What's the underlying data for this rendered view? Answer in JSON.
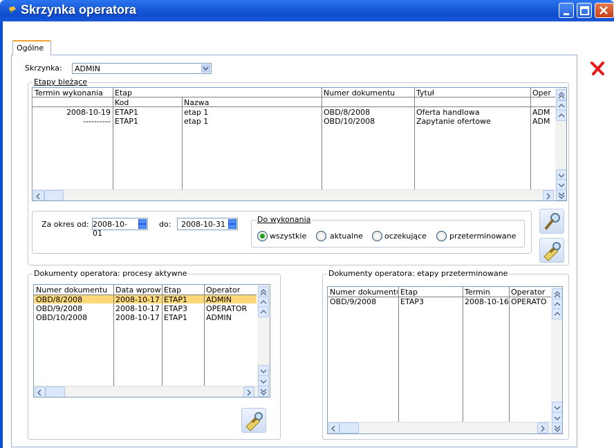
{
  "window": {
    "title": "Skrzynka operatora"
  },
  "tabs": [
    {
      "label": "Ogólne"
    }
  ],
  "skrzynka": {
    "label": "Skrzynka:",
    "value": "ADMIN"
  },
  "etapy": {
    "legend": "Etapy bieżące",
    "headers": {
      "termin": "Termin wykonania",
      "etap": "Etap",
      "kod": "Kod",
      "nazwa": "Nazwa",
      "numer": "Numer dokumentu",
      "tytul": "Tytuł",
      "operator": "Oper"
    },
    "rows": [
      {
        "termin": "2008-10-19",
        "kod": "ETAP1",
        "nazwa": "etap 1",
        "numer": "OBD/8/2008",
        "tytul": "Oferta handlowa",
        "operator": "ADM"
      },
      {
        "termin": "----------",
        "kod": "ETAP1",
        "nazwa": "etap 1",
        "numer": "OBD/10/2008",
        "tytul": "Zapytanie ofertowe",
        "operator": "ADM"
      }
    ]
  },
  "filter": {
    "okres_label": "Za okres od:",
    "od": "2008-10-01",
    "do_label": "do:",
    "do": "2008-10-31",
    "wykonanie_legend": "Do wykonania",
    "options": [
      "wszystkie",
      "aktualne",
      "oczekujące",
      "przeterminowane"
    ],
    "selected": "wszystkie"
  },
  "procesy": {
    "legend": "Dokumenty operatora: procesy aktywne",
    "headers": [
      "Numer dokumentu",
      "Data wprow",
      "Etap",
      "Operator"
    ],
    "rows": [
      [
        "OBD/8/2008",
        "2008-10-17",
        "ETAP1",
        "ADMIN"
      ],
      [
        "OBD/9/2008",
        "2008-10-17",
        "ETAP3",
        "OPERATOR"
      ],
      [
        "OBD/10/2008",
        "2008-10-17",
        "ETAP1",
        "ADMIN"
      ]
    ],
    "selected_row": 0
  },
  "przeterminowane": {
    "legend": "Dokumenty operatora: etapy przeterminowane",
    "headers": [
      "Numer dokumentu",
      "Etap",
      "Termin",
      "Operator"
    ],
    "rows": [
      [
        "OBD/9/2008",
        "ETAP3",
        "2008-10-16",
        "OPERATO"
      ]
    ]
  },
  "icons": {
    "title": "window-icon",
    "close": "close-x-icon",
    "search": "magnifier-icon",
    "edit": "magnifier-pencil-icon"
  },
  "colors": {
    "titlebar": "#1a5bd8",
    "selection": "#fdd878",
    "close_red": "#e81818",
    "radio_on": "#21a121"
  }
}
